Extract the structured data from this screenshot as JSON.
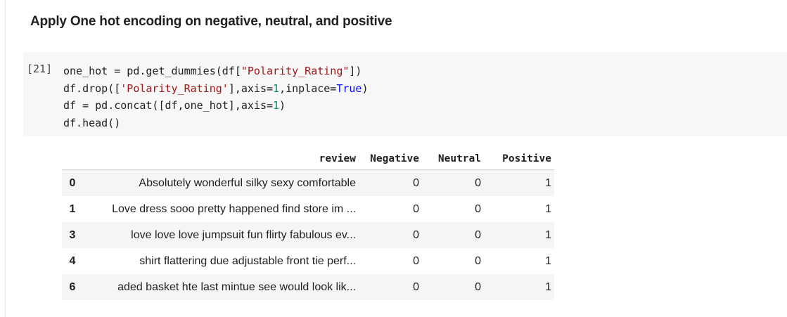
{
  "heading": "Apply One hot encoding on negative, neutral, and positive",
  "cell": {
    "execution_count": "[21]",
    "code_lines": [
      "one_hot = pd.get_dummies(df[\"Polarity_Rating\"])",
      "df.drop(['Polarity_Rating'],axis=1,inplace=True)",
      "df = pd.concat([df,one_hot],axis=1)",
      "df.head()"
    ]
  },
  "output_table": {
    "columns": [
      "",
      "review",
      "Negative",
      "Neutral",
      "Positive"
    ],
    "rows": [
      {
        "index": "0",
        "review": "Absolutely wonderful silky sexy comfortable",
        "negative": "0",
        "neutral": "0",
        "positive": "1"
      },
      {
        "index": "1",
        "review": "Love dress sooo pretty happened find store im ...",
        "negative": "0",
        "neutral": "0",
        "positive": "1"
      },
      {
        "index": "3",
        "review": "love love love jumpsuit fun flirty fabulous ev...",
        "negative": "0",
        "neutral": "0",
        "positive": "1"
      },
      {
        "index": "4",
        "review": "shirt flattering due adjustable front tie perf...",
        "negative": "0",
        "neutral": "0",
        "positive": "1"
      },
      {
        "index": "6",
        "review": "aded basket hte last mintue see would look lik...",
        "negative": "0",
        "neutral": "0",
        "positive": "1"
      }
    ]
  },
  "colors": {
    "string": "#a31515",
    "number": "#09885a",
    "keyword": "#0000ff",
    "cell_background": "#f7f7f7",
    "stripe": "#f5f5f5"
  }
}
